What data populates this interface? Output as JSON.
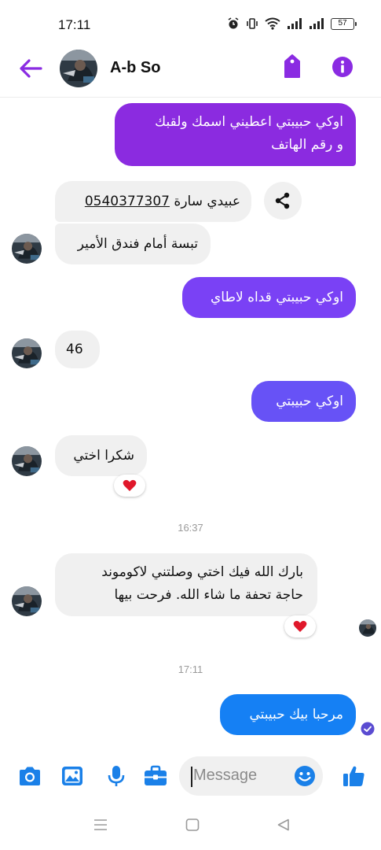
{
  "status_bar": {
    "time": "17:11",
    "battery": "57"
  },
  "header": {
    "contact_name": "A-b So"
  },
  "messages": [
    {
      "id": "m1",
      "direction": "outgoing",
      "lines": [
        "اوكي حبيبتي اعطيني اسمك ولقبك",
        "و رقم الهاتف"
      ]
    },
    {
      "id": "m2",
      "direction": "incoming",
      "name_text": "عبيدي سارة",
      "phone": "0540377307"
    },
    {
      "id": "m3",
      "direction": "incoming",
      "text": "تبسة أمام فندق الأمير"
    },
    {
      "id": "m4",
      "direction": "outgoing",
      "text": "اوكي حبيبتي قداه لاطاي"
    },
    {
      "id": "m5",
      "direction": "incoming",
      "text": "46"
    },
    {
      "id": "m6",
      "direction": "outgoing",
      "text": "اوكي حبيبتي"
    },
    {
      "id": "m7",
      "direction": "incoming",
      "text": "شكرا اختي",
      "reaction": "heart"
    },
    {
      "id": "m8",
      "direction": "incoming",
      "lines": [
        "بارك الله فيك اختي وصلتني لاكوموند",
        "حاجة تحفة ما شاء الله. فرحت بيها"
      ],
      "reaction": "heart"
    },
    {
      "id": "m9",
      "direction": "outgoing",
      "text": "مرحبا بيك حبيبتي",
      "status": "delivered"
    }
  ],
  "timestamps": [
    "16:37",
    "17:11"
  ],
  "composer": {
    "placeholder": "Message"
  },
  "colors": {
    "accent": "#8a2be2",
    "bubble_gradient": [
      "#8b2be0",
      "#7a41f5",
      "#6752f6",
      "#1580f4"
    ],
    "incoming_bubble": "#f0f0f0",
    "composer_icons": "#1a80e8",
    "reaction_heart": "#e0182b"
  },
  "icons": {
    "back": "arrow-left-icon",
    "tag": "tag-icon",
    "info": "info-icon",
    "share": "share-icon",
    "camera": "camera-icon",
    "gallery": "image-icon",
    "mic": "microphone-icon",
    "toolbox": "briefcase-icon",
    "emoji": "smiley-icon",
    "like": "thumbs-up-icon"
  }
}
